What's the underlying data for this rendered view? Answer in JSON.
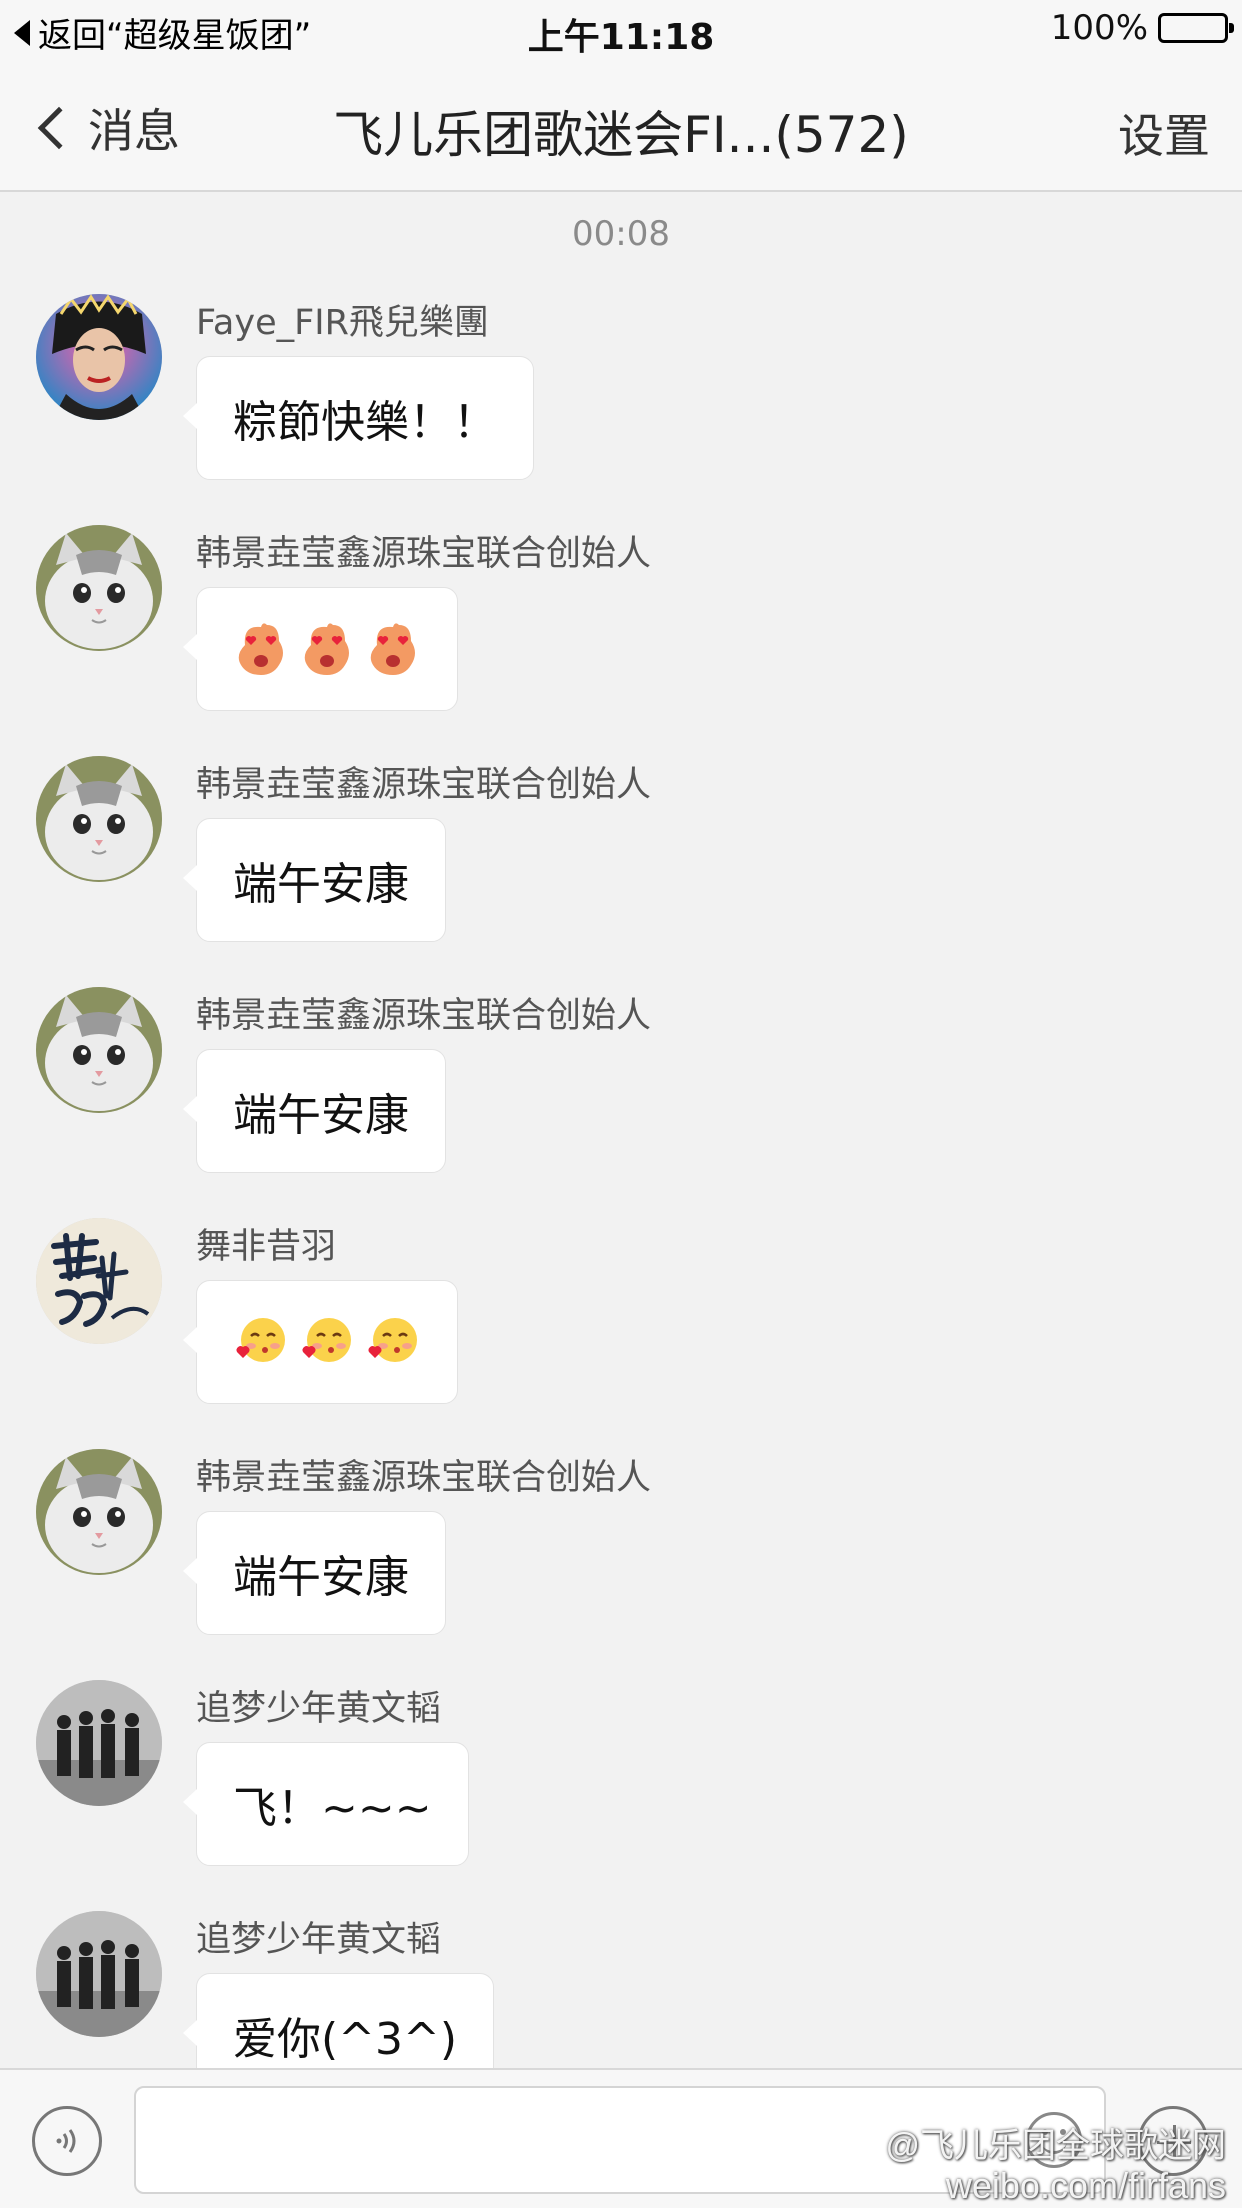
{
  "status_bar": {
    "back_app": "返回“超级星饭团”",
    "time": "上午11:18",
    "battery": "100%"
  },
  "nav": {
    "back_label": "消息",
    "title": "飞儿乐团歌迷会FI...(572)",
    "settings_label": "设置"
  },
  "chat": {
    "timestamp": "00:08",
    "messages": [
      {
        "sender": "Faye_FIR飛兒樂團",
        "text": "粽節快樂！！",
        "avatar": "faye-portrait"
      },
      {
        "sender": "韩景垚莹鑫源珠宝联合创始人",
        "text": "",
        "emoji": "heart-eyes-emoji",
        "emoji_count": 3,
        "avatar": "cat"
      },
      {
        "sender": "韩景垚莹鑫源珠宝联合创始人",
        "text": "端午安康",
        "avatar": "cat"
      },
      {
        "sender": "韩景垚莹鑫源珠宝联合创始人",
        "text": "端午安康",
        "avatar": "cat"
      },
      {
        "sender": "舞非昔羽",
        "text": "",
        "emoji": "kiss-emoji",
        "emoji_count": 3,
        "avatar": "calligraphy"
      },
      {
        "sender": "韩景垚莹鑫源珠宝联合创始人",
        "text": "端午安康",
        "avatar": "cat"
      },
      {
        "sender": "追梦少年黄文韬",
        "text": "飞！~~~",
        "avatar": "band-photo"
      },
      {
        "sender": "追梦少年黄文韬",
        "text": "爱你(^3^)",
        "avatar": "band-photo"
      }
    ]
  },
  "input_bar": {
    "voice_icon": "voice-icon",
    "emoji_icon": "smile-icon",
    "add_icon": "plus-icon"
  },
  "watermark": {
    "line1": "@飞儿乐团全球歌迷网",
    "line2": "weibo.com/firfans"
  }
}
